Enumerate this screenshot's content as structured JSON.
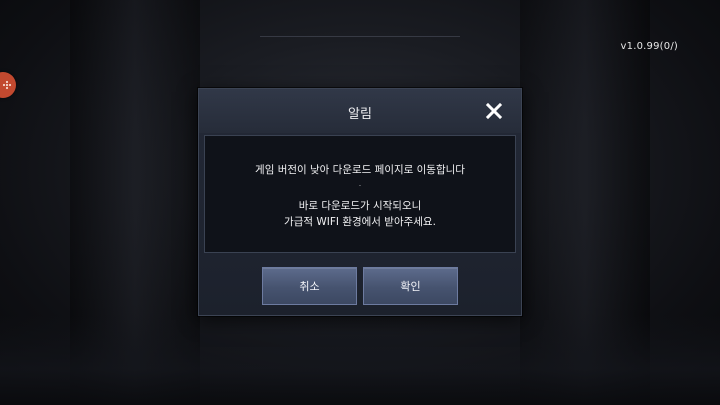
{
  "version_label": "v1.0.99(0/)",
  "dialog": {
    "title": "알림",
    "message": {
      "line1": "게임 버전이 낮아 다운로드 페이지로 이동합니다",
      "separator": ".",
      "line2": "바로 다운로드가 시작되오니",
      "line3": "가급적 WIFI 환경에서 받아주세요."
    },
    "cancel_label": "취소",
    "confirm_label": "확인",
    "close_icon": "close-icon"
  },
  "side_handle_icon": "grip-dots-icon",
  "colors": {
    "dialog_bg": "#1f2430",
    "message_bg": "#0f1219",
    "button_bg": "#4f5c7a",
    "side_handle": "#c2492f"
  }
}
